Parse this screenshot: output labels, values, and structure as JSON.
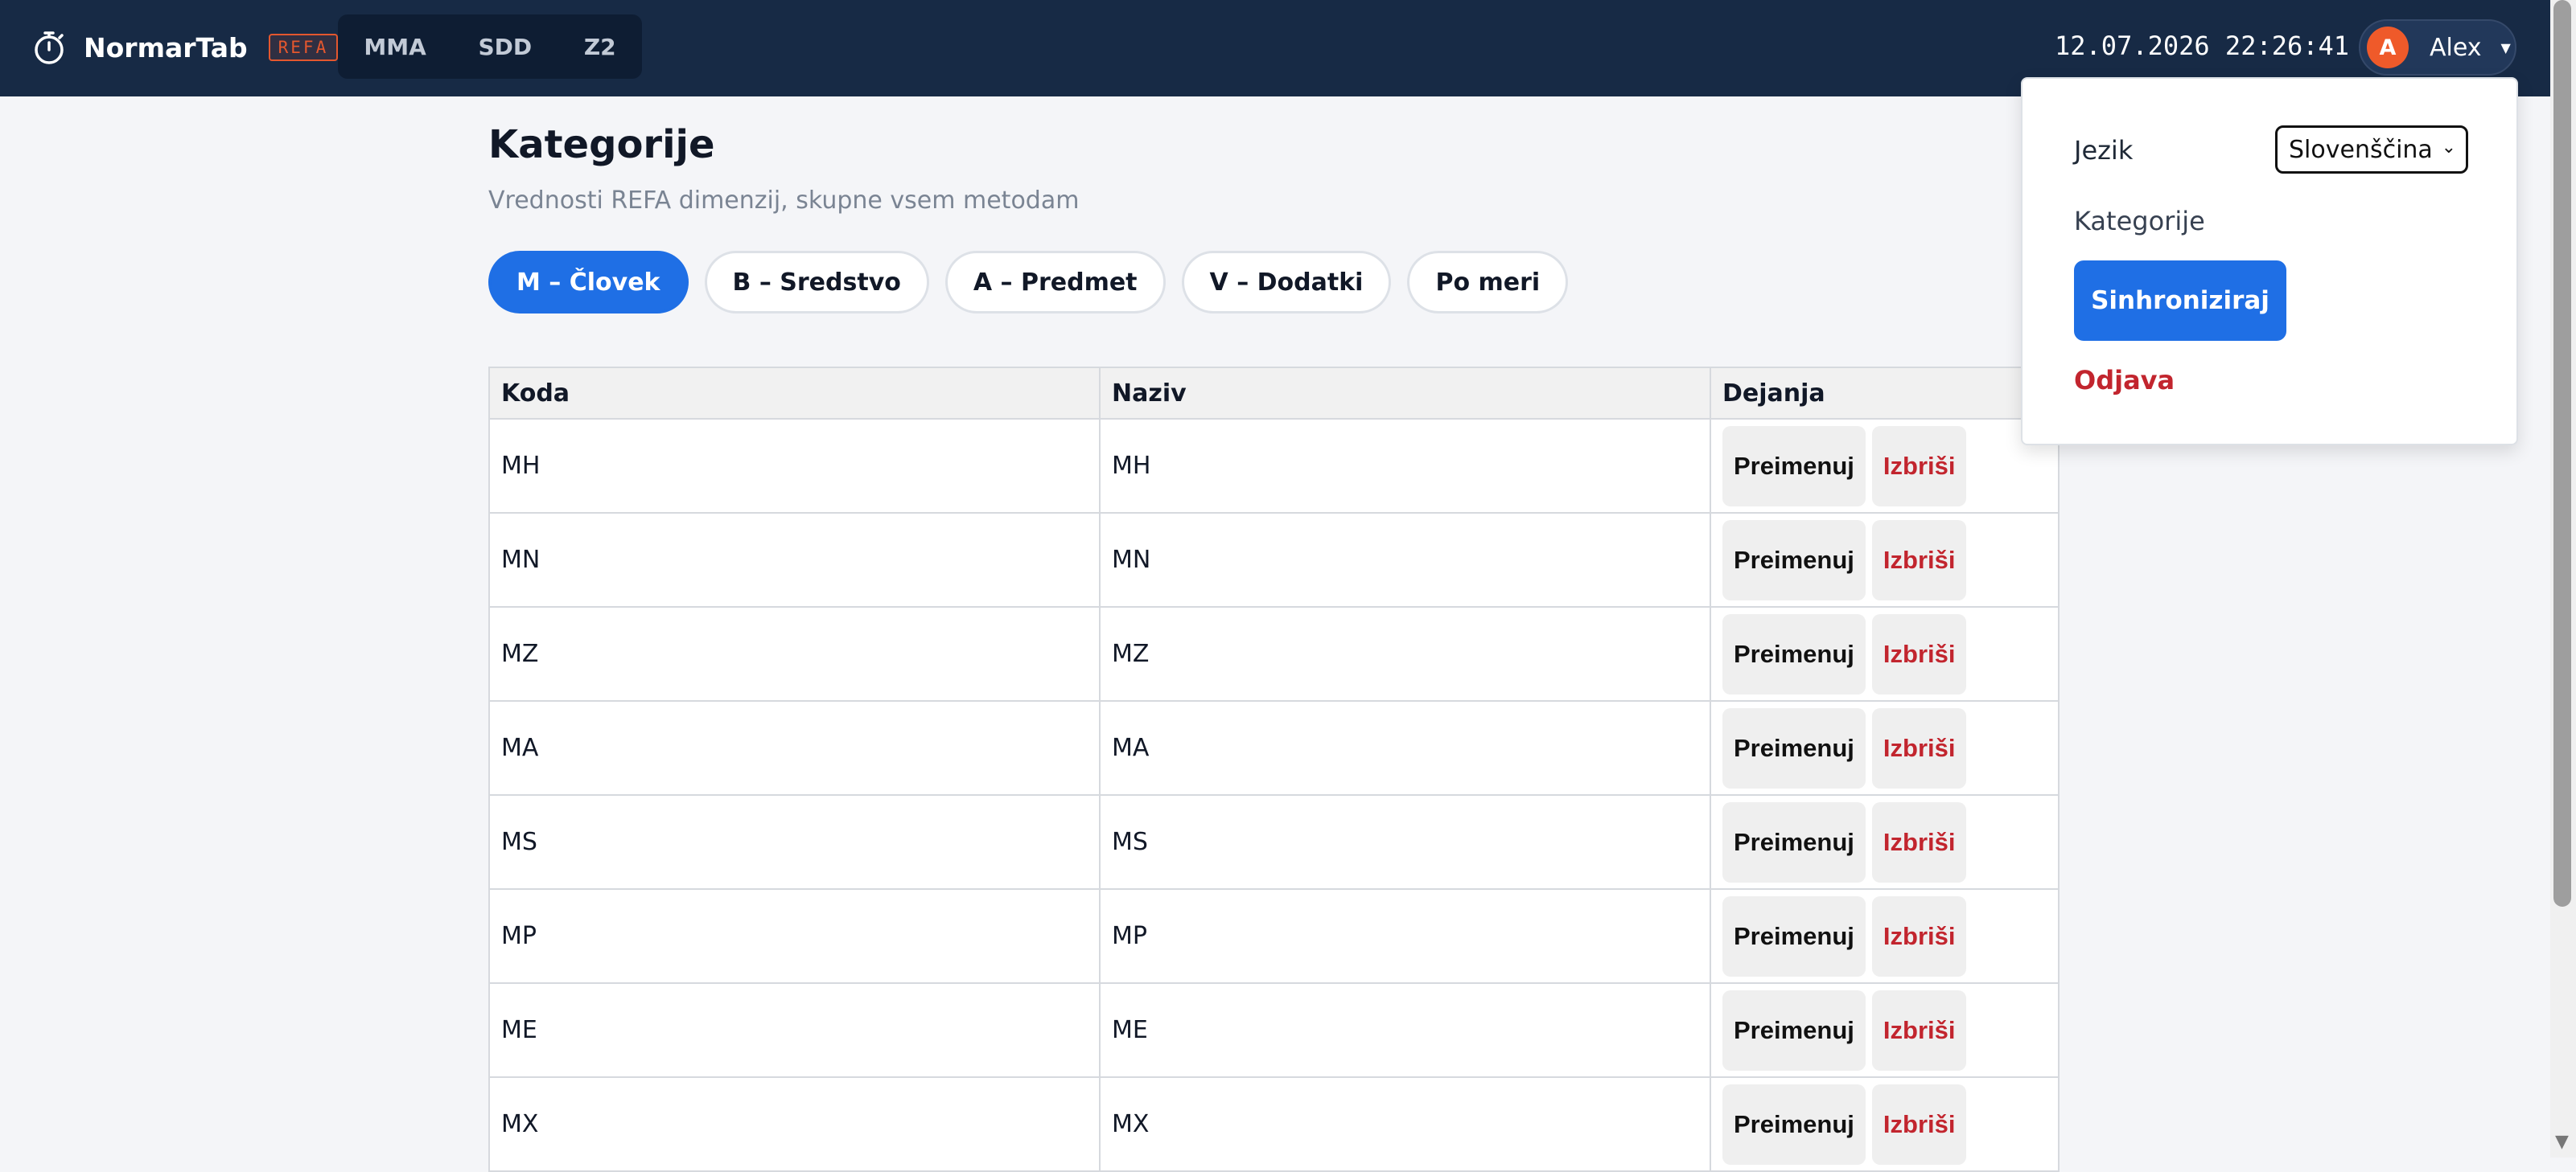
{
  "header": {
    "app_name": "NormarTab",
    "badge": "REFA",
    "tabs": [
      {
        "label": "MMA"
      },
      {
        "label": "SDD"
      },
      {
        "label": "Z2"
      }
    ],
    "datetime": "12.07.2026 22:26:41",
    "user": {
      "initial": "A",
      "name": "Alex"
    }
  },
  "page": {
    "title": "Kategorije",
    "subtitle": "Vrednosti REFA dimenzij, skupne vsem metodam"
  },
  "category_tabs": [
    {
      "label": "M – Človek",
      "active": true
    },
    {
      "label": "B – Sredstvo",
      "active": false
    },
    {
      "label": "A – Predmet",
      "active": false
    },
    {
      "label": "V – Dodatki",
      "active": false
    },
    {
      "label": "Po meri",
      "active": false
    }
  ],
  "table": {
    "headers": {
      "code": "Koda",
      "name": "Naziv",
      "actions": "Dejanja"
    },
    "rename_label": "Preimenuj",
    "delete_label": "Izbriši",
    "rows": [
      {
        "code": "MH",
        "name": "MH"
      },
      {
        "code": "MN",
        "name": "MN"
      },
      {
        "code": "MZ",
        "name": "MZ"
      },
      {
        "code": "MA",
        "name": "MA"
      },
      {
        "code": "MS",
        "name": "MS"
      },
      {
        "code": "MP",
        "name": "MP"
      },
      {
        "code": "ME",
        "name": "ME"
      },
      {
        "code": "MX",
        "name": "MX"
      }
    ]
  },
  "dropdown": {
    "language_label": "Jezik",
    "language_value": "Slovenščina",
    "categories_label": "Kategorije",
    "sync_label": "Sinhroniziraj",
    "logout_label": "Odjava"
  },
  "colors": {
    "topbar": "#172a45",
    "accent": "#1f6fe5",
    "danger": "#c2252e",
    "avatar": "#ef5a2a"
  }
}
